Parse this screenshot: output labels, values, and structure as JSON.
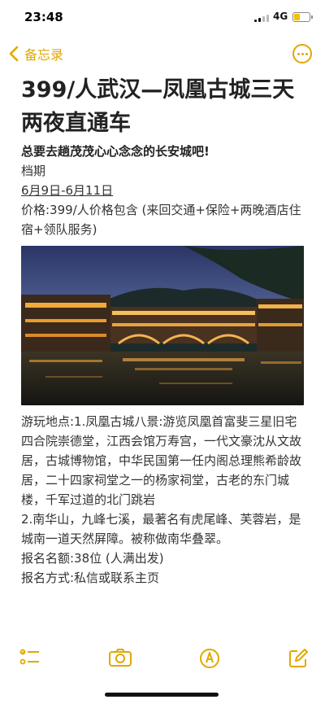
{
  "status_bar": {
    "time": "23:48",
    "network": "4G"
  },
  "nav": {
    "back_label": "备忘录"
  },
  "note": {
    "title": "399/人武汉—凤凰古城三天两夜直通车",
    "subtitle": "总要去趟茂茂心心念念的长安城吧!",
    "lines": [
      "档期",
      "6月9日-6月11日",
      "价格:399/人价格包含 (来回交通+保险+两晚酒店住宿+领队服务)"
    ],
    "paragraphs": [
      "游玩地点:1.凤凰古城八景:游览凤凰首富斐三星旧宅四合院崇德堂，江西会馆万寿宫，一代文豪沈从文故居，古城博物馆，中华民国第一任内阁总理熊希龄故居，二十四家祠堂之一的杨家祠堂，古老的东门城楼，千军过道的北门跳岩",
      "2.南华山，九峰七溪，最著名有虎尾峰、芙蓉岩，是城南一道天然屏障。被称做南华叠翠。",
      "报名名额:38位 (人满出发)",
      "报名方式:私信或联系主页"
    ]
  },
  "colors": {
    "accent": "#e0a800"
  },
  "toolbar_icons": [
    "checklist-icon",
    "camera-icon",
    "markup-icon",
    "compose-icon"
  ]
}
